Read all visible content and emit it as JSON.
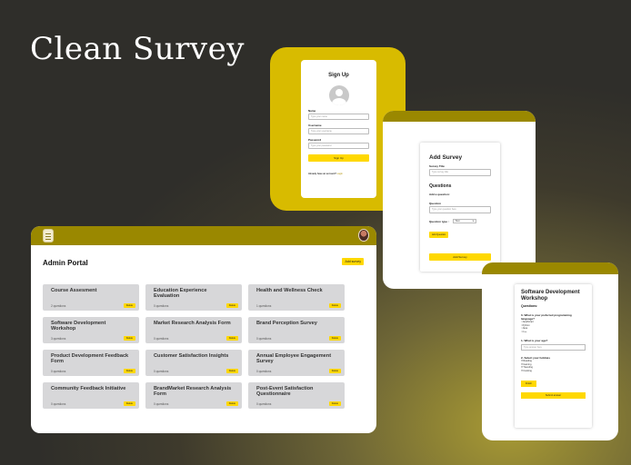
{
  "hero": {
    "title": "Clean Survey"
  },
  "signup": {
    "title": "Sign Up",
    "name_label": "Name",
    "name_placeholder": "Type your name",
    "username_label": "Username",
    "username_placeholder": "Type your username",
    "password_label": "Password",
    "password_placeholder": "Type your password",
    "submit_label": "Sign Up",
    "login_prompt": "Already have an account?",
    "login_link": "Login"
  },
  "add_survey": {
    "title": "Add Survey",
    "survey_title_label": "Survey Title",
    "survey_title_placeholder": "Type survey title",
    "questions_heading": "Questions",
    "add_question_label": "Add a question:",
    "question_label": "Question",
    "question_placeholder": "Type your question here",
    "question_type_label": "Question type :",
    "question_type_value": "Text",
    "add_question_button": "Add Question",
    "submit_button": "Add Survey"
  },
  "software_survey": {
    "title": "Software Development Workshop",
    "subtitle": "Questions:",
    "q0": "0- What is your preferred programming language?",
    "q0_options": [
      "JavaScript",
      "Python",
      "Java",
      "C++"
    ],
    "q1": "1- What is your age?",
    "q1_placeholder": "Type answer here",
    "q2": "2- Select your hobbies",
    "q2_options": [
      "Reading",
      "Gaming",
      "Traveling",
      "Cooking"
    ],
    "finish_button": "Finish",
    "submit_button": "Submit answer"
  },
  "admin": {
    "title": "Admin Portal",
    "add_button": "Add survey",
    "surveys": [
      {
        "name": "Course Assesment",
        "count": "2 questions",
        "button": "Delete"
      },
      {
        "name": "Education Experience Evaluation",
        "count": "0 questions",
        "button": "Delete"
      },
      {
        "name": "Health and Wellness Check",
        "count": "1 questions",
        "button": "Delete"
      },
      {
        "name": "Software Development Workshop",
        "count": "3 questions",
        "button": "Delete"
      },
      {
        "name": "Market Research Analysis Form",
        "count": "0 questions",
        "button": "Delete"
      },
      {
        "name": "Brand Perception Survey",
        "count": "0 questions",
        "button": "Delete"
      },
      {
        "name": "Product Development Feedback Form",
        "count": "0 questions",
        "button": "Delete"
      },
      {
        "name": "Customer Satisfaction Insights",
        "count": "0 questions",
        "button": "Delete"
      },
      {
        "name": "Annual Employee Engagement Survey",
        "count": "0 questions",
        "button": "Delete"
      },
      {
        "name": "Community Feedback Initiative",
        "count": "0 questions",
        "button": "Delete"
      },
      {
        "name": "BrandMarket Research Analysis Form",
        "count": "0 questions",
        "button": "Delete"
      },
      {
        "name": "Post-Event Satisfaction Questionnaire",
        "count": "0 questions",
        "button": "Delete"
      }
    ]
  },
  "colors": {
    "accent_yellow": "#ffd800",
    "olive_band": "#9a8800",
    "signup_frame": "#d8bb00",
    "card_gray": "#d7d7d9"
  }
}
